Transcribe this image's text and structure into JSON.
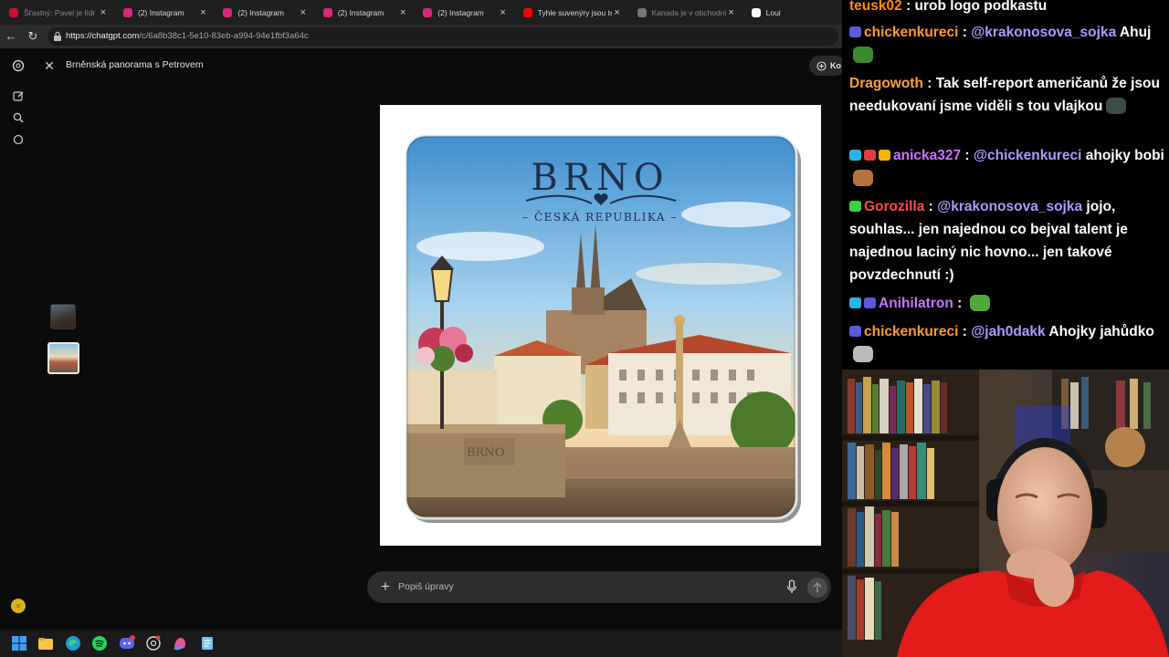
{
  "browser": {
    "tabs": [
      {
        "title": "Šťastný: Pavel je lídr opo",
        "favicon": "in-icon",
        "color": "#c8102e",
        "dim": true
      },
      {
        "title": "(2) Instagram",
        "favicon": "instagram-icon",
        "color": "#d62976"
      },
      {
        "title": "(2) Instagram",
        "favicon": "instagram-icon",
        "color": "#d62976"
      },
      {
        "title": "(2) Instagram",
        "favicon": "instagram-icon",
        "color": "#d62976"
      },
      {
        "title": "(2) Instagram",
        "favicon": "instagram-icon",
        "color": "#d62976"
      },
      {
        "title": "Tyhle suvenýry jsou teď",
        "favicon": "youtube-icon",
        "color": "#ff0000"
      },
      {
        "title": "Kanada je v obchodní vá",
        "favicon": "page-icon",
        "color": "#777777",
        "dim": true
      },
      {
        "title": "Loui",
        "favicon": "x-icon",
        "color": "#ffffff"
      }
    ],
    "url_bold": "https://chatgpt.com",
    "url_rest": "/c/6a8b38c1-5e10-83eb-a994-94e1fbf3a64c"
  },
  "app": {
    "title": "Brněnská panorama s Petrovem",
    "top_button": "Ko",
    "chat_placeholder": "Popiš úpravy"
  },
  "image": {
    "heading": "BRNO",
    "subheading": "– ČESKÁ REPUBLIKA –",
    "stone_text": "BRNO"
  },
  "twitch": {
    "messages": [
      {
        "user": "teusk02",
        "user_color": "#ff8c1a",
        "text": "urob logo podkastu",
        "badges": []
      },
      {
        "user": "chickenkureci",
        "user_color": "#ff9a2e",
        "mention": "@krakonosova_sojka",
        "text": "Ahuj",
        "badges": [
          "#5a5ad8"
        ],
        "emote": "#3a8a2e"
      },
      {
        "user": "Dragowoth",
        "user_color": "#ffa23c",
        "text": "Tak self-report američanů že jsou needukovaní jsme viděli s tou vlajkou",
        "badges": [],
        "emote": "#3e4a44"
      },
      {
        "user": "anicka327",
        "user_color": "#d070ff",
        "mention": "@chickenkureci",
        "text": "ahojky bobi",
        "badges": [
          "#2ab3e6",
          "#e23d3d",
          "#f2b705"
        ],
        "emote": "#b8703a"
      },
      {
        "user": "Gorozilla",
        "user_color": "#ff4a4a",
        "mention": "@krakonosova_sojka",
        "text": "jojo, souhlas... jen najednou co bejval talent je najednou laciný nic hovno... jen takové povzdechnutí :)",
        "badges": [
          "#3ecf3e"
        ]
      },
      {
        "user": "Anihilatron",
        "user_color": "#c478ff",
        "text": "",
        "badges": [
          "#2ab3e6",
          "#5a5ad8"
        ],
        "emote": "#4fa83a"
      },
      {
        "user": "chickenkureci",
        "user_color": "#ff9a2e",
        "mention": "@jah0dakk",
        "text": "Ahojky jahůdko",
        "badges": [
          "#5a5ad8"
        ],
        "emote": "#bcbcbc"
      }
    ]
  },
  "colors": {
    "accent_mention": "#a99cff",
    "avatar": "#d6b21c"
  }
}
